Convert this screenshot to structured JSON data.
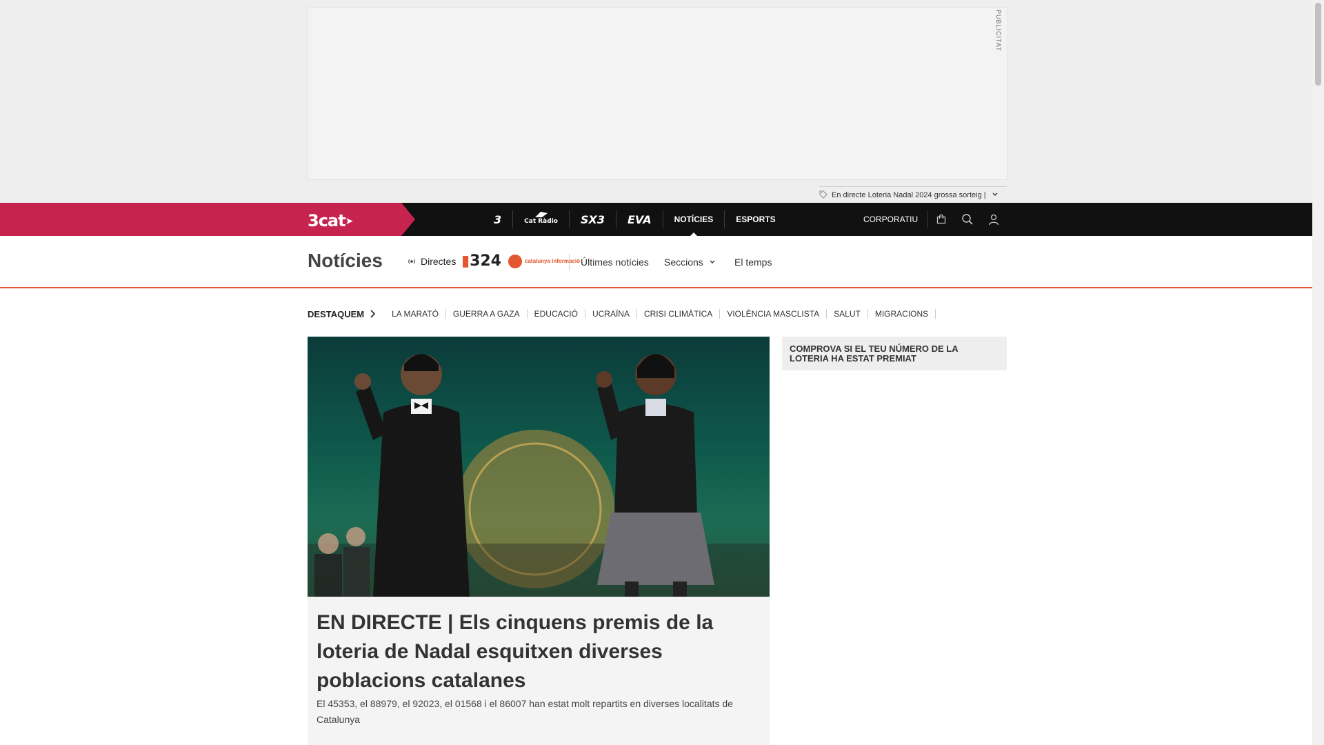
{
  "ad": {
    "label": "PUBLICITAT",
    "ticker_text": "En directe Loteria Nadal 2024 grossa sorteig |"
  },
  "topbar": {
    "brand": "3cat",
    "channels": [
      {
        "label": "3"
      },
      {
        "label": "Cat Ràdio"
      },
      {
        "label": "SX3"
      },
      {
        "label": "EVA"
      }
    ],
    "nav": [
      {
        "label": "NOTÍCIES",
        "active": true
      },
      {
        "label": "ESPORTS",
        "active": false
      }
    ],
    "corporate": "CORPORATIU",
    "icons": [
      "shopping-bag-icon",
      "search-icon",
      "user-icon"
    ]
  },
  "subnav": {
    "title": "Notícies",
    "directes": "Directes",
    "logo_324": "324",
    "logo_ci": "catalunya informació",
    "links": [
      "Últimes notícies",
      "Seccions",
      "El temps"
    ]
  },
  "highlights": {
    "label": "DESTAQUEM",
    "items": [
      "LA MARATÓ",
      "GUERRA A GAZA",
      "EDUCACIÓ",
      "UCRAÏNA",
      "CRISI CLIMÀTICA",
      "VIOLÈNCIA MASCLISTA",
      "SALUT",
      "MIGRACIONS"
    ]
  },
  "hero": {
    "title": "EN DIRECTE | Els cinquens premis de la loteria de Nadal esquitxen diverses poblacions catalanes",
    "subtitle": "El 45353, el 88979, el 92023, el 01568 i el 86007 han estat molt repartits en diverses localitats de Catalunya"
  },
  "promo": {
    "text": "COMPROVA SI EL TEU NÚMERO DE LA LOTERIA HA ESTAT PREMIAT"
  },
  "colors": {
    "brand": "#c6234e",
    "topbar": "#111111",
    "accent": "#e4572e"
  }
}
